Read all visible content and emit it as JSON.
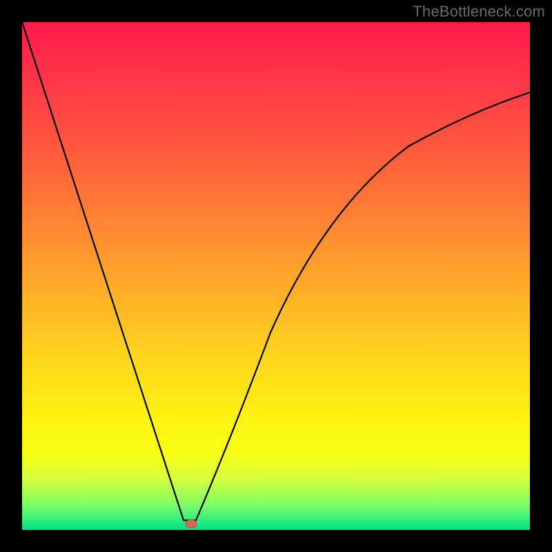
{
  "watermark": "TheBottleneck.com",
  "chart_data": {
    "type": "line",
    "title": "",
    "xlabel": "",
    "ylabel": "",
    "xlim": [
      0,
      1
    ],
    "ylim": [
      0,
      1
    ],
    "x": [
      0.0,
      0.05,
      0.1,
      0.15,
      0.2,
      0.25,
      0.3,
      0.32,
      0.33,
      0.35,
      0.4,
      0.45,
      0.5,
      0.55,
      0.6,
      0.65,
      0.7,
      0.75,
      0.8,
      0.85,
      0.9,
      0.95,
      1.0
    ],
    "y": [
      1.0,
      0.85,
      0.7,
      0.55,
      0.39,
      0.24,
      0.08,
      0.02,
      0.0,
      0.02,
      0.15,
      0.3,
      0.42,
      0.52,
      0.6,
      0.67,
      0.72,
      0.76,
      0.79,
      0.82,
      0.84,
      0.85,
      0.86
    ],
    "minimum_point": {
      "x": 0.33,
      "y": 0.0
    },
    "background_gradient": {
      "top": "#ff1a4b",
      "mid": "#ffd21e",
      "bottom": "#00e38a"
    }
  }
}
